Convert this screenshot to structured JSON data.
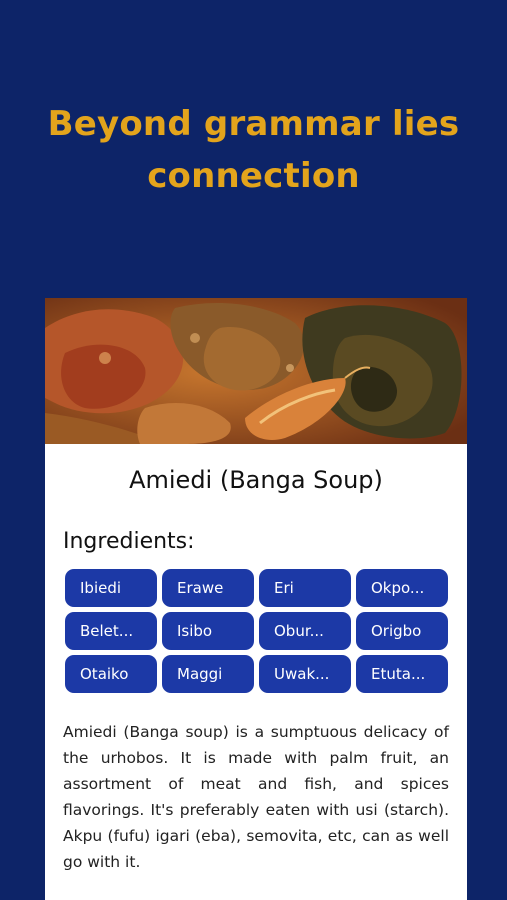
{
  "headline": "Beyond grammar lies connection",
  "card": {
    "image_icon": "banga-soup-photo",
    "title": "Amiedi (Banga Soup)",
    "ingredients_label": "Ingredients:",
    "ingredients": [
      "Ibiedi",
      "Erawe",
      "Eri",
      "Okpo...",
      "Belet...",
      "Isibo",
      "Obur...",
      "Origbo",
      "Otaiko",
      "Maggi",
      "Uwak...",
      "Etuta..."
    ],
    "description": "Amiedi (Banga soup) is a sumptuous delicacy of the urhobos. It is made with palm fruit, an assortment of meat and fish, and spices flavorings. It's preferably eaten with usi (starch). Akpu (fufu) igari (eba), semovita, etc, can as well go with it."
  },
  "colors": {
    "background": "#0d2468",
    "headline": "#e3a41c",
    "chip": "#1c39a6",
    "card": "#ffffff"
  }
}
